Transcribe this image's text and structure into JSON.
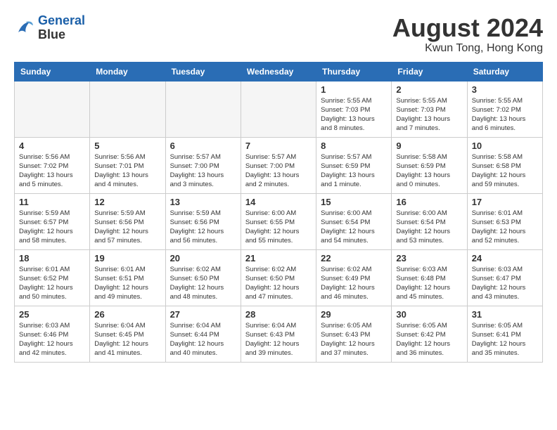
{
  "header": {
    "logo_line1": "General",
    "logo_line2": "Blue",
    "month": "August 2024",
    "location": "Kwun Tong, Hong Kong"
  },
  "weekdays": [
    "Sunday",
    "Monday",
    "Tuesday",
    "Wednesday",
    "Thursday",
    "Friday",
    "Saturday"
  ],
  "weeks": [
    [
      {
        "day": "",
        "empty": true
      },
      {
        "day": "",
        "empty": true
      },
      {
        "day": "",
        "empty": true
      },
      {
        "day": "",
        "empty": true
      },
      {
        "day": "1",
        "sunrise": "5:55 AM",
        "sunset": "7:03 PM",
        "daylight": "13 hours and 8 minutes."
      },
      {
        "day": "2",
        "sunrise": "5:55 AM",
        "sunset": "7:03 PM",
        "daylight": "13 hours and 7 minutes."
      },
      {
        "day": "3",
        "sunrise": "5:55 AM",
        "sunset": "7:02 PM",
        "daylight": "13 hours and 6 minutes."
      }
    ],
    [
      {
        "day": "4",
        "sunrise": "5:56 AM",
        "sunset": "7:02 PM",
        "daylight": "13 hours and 5 minutes."
      },
      {
        "day": "5",
        "sunrise": "5:56 AM",
        "sunset": "7:01 PM",
        "daylight": "13 hours and 4 minutes."
      },
      {
        "day": "6",
        "sunrise": "5:57 AM",
        "sunset": "7:00 PM",
        "daylight": "13 hours and 3 minutes."
      },
      {
        "day": "7",
        "sunrise": "5:57 AM",
        "sunset": "7:00 PM",
        "daylight": "13 hours and 2 minutes."
      },
      {
        "day": "8",
        "sunrise": "5:57 AM",
        "sunset": "6:59 PM",
        "daylight": "13 hours and 1 minute."
      },
      {
        "day": "9",
        "sunrise": "5:58 AM",
        "sunset": "6:59 PM",
        "daylight": "13 hours and 0 minutes."
      },
      {
        "day": "10",
        "sunrise": "5:58 AM",
        "sunset": "6:58 PM",
        "daylight": "12 hours and 59 minutes."
      }
    ],
    [
      {
        "day": "11",
        "sunrise": "5:59 AM",
        "sunset": "6:57 PM",
        "daylight": "12 hours and 58 minutes."
      },
      {
        "day": "12",
        "sunrise": "5:59 AM",
        "sunset": "6:56 PM",
        "daylight": "12 hours and 57 minutes."
      },
      {
        "day": "13",
        "sunrise": "5:59 AM",
        "sunset": "6:56 PM",
        "daylight": "12 hours and 56 minutes."
      },
      {
        "day": "14",
        "sunrise": "6:00 AM",
        "sunset": "6:55 PM",
        "daylight": "12 hours and 55 minutes."
      },
      {
        "day": "15",
        "sunrise": "6:00 AM",
        "sunset": "6:54 PM",
        "daylight": "12 hours and 54 minutes."
      },
      {
        "day": "16",
        "sunrise": "6:00 AM",
        "sunset": "6:54 PM",
        "daylight": "12 hours and 53 minutes."
      },
      {
        "day": "17",
        "sunrise": "6:01 AM",
        "sunset": "6:53 PM",
        "daylight": "12 hours and 52 minutes."
      }
    ],
    [
      {
        "day": "18",
        "sunrise": "6:01 AM",
        "sunset": "6:52 PM",
        "daylight": "12 hours and 50 minutes."
      },
      {
        "day": "19",
        "sunrise": "6:01 AM",
        "sunset": "6:51 PM",
        "daylight": "12 hours and 49 minutes."
      },
      {
        "day": "20",
        "sunrise": "6:02 AM",
        "sunset": "6:50 PM",
        "daylight": "12 hours and 48 minutes."
      },
      {
        "day": "21",
        "sunrise": "6:02 AM",
        "sunset": "6:50 PM",
        "daylight": "12 hours and 47 minutes."
      },
      {
        "day": "22",
        "sunrise": "6:02 AM",
        "sunset": "6:49 PM",
        "daylight": "12 hours and 46 minutes."
      },
      {
        "day": "23",
        "sunrise": "6:03 AM",
        "sunset": "6:48 PM",
        "daylight": "12 hours and 45 minutes."
      },
      {
        "day": "24",
        "sunrise": "6:03 AM",
        "sunset": "6:47 PM",
        "daylight": "12 hours and 43 minutes."
      }
    ],
    [
      {
        "day": "25",
        "sunrise": "6:03 AM",
        "sunset": "6:46 PM",
        "daylight": "12 hours and 42 minutes."
      },
      {
        "day": "26",
        "sunrise": "6:04 AM",
        "sunset": "6:45 PM",
        "daylight": "12 hours and 41 minutes."
      },
      {
        "day": "27",
        "sunrise": "6:04 AM",
        "sunset": "6:44 PM",
        "daylight": "12 hours and 40 minutes."
      },
      {
        "day": "28",
        "sunrise": "6:04 AM",
        "sunset": "6:43 PM",
        "daylight": "12 hours and 39 minutes."
      },
      {
        "day": "29",
        "sunrise": "6:05 AM",
        "sunset": "6:43 PM",
        "daylight": "12 hours and 37 minutes."
      },
      {
        "day": "30",
        "sunrise": "6:05 AM",
        "sunset": "6:42 PM",
        "daylight": "12 hours and 36 minutes."
      },
      {
        "day": "31",
        "sunrise": "6:05 AM",
        "sunset": "6:41 PM",
        "daylight": "12 hours and 35 minutes."
      }
    ]
  ]
}
